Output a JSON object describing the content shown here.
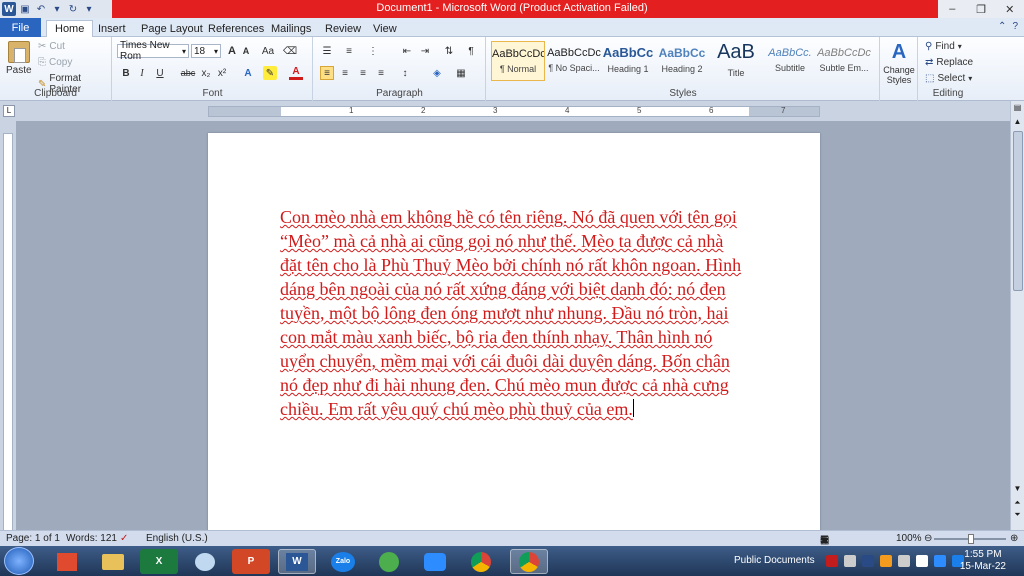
{
  "app": {
    "title": "Document1 - Microsoft Word (Product Activation Failed)",
    "logo_letter": "W"
  },
  "tabs": [
    "File",
    "Home",
    "Insert",
    "Page Layout",
    "References",
    "Mailings",
    "Review",
    "View"
  ],
  "clipboard": {
    "paste": "Paste",
    "cut": "Cut",
    "copy": "Copy",
    "format_painter": "Format Painter",
    "label": "Clipboard"
  },
  "font": {
    "name": "Times New Rom",
    "size": "18",
    "label": "Font",
    "bold": "B",
    "italic": "I",
    "underline": "U",
    "strike": "abc",
    "subscript": "x₂",
    "superscript": "x²",
    "grow": "A",
    "shrink": "A",
    "case": "Aa"
  },
  "paragraph": {
    "label": "Paragraph"
  },
  "styles": {
    "label": "Styles",
    "items": [
      {
        "sample": "AaBbCcDc",
        "name": "¶ Normal"
      },
      {
        "sample": "AaBbCcDc",
        "name": "¶ No Spaci..."
      },
      {
        "sample": "AaBbCc",
        "name": "Heading 1"
      },
      {
        "sample": "AaBbCc",
        "name": "Heading 2"
      },
      {
        "sample": "AaB",
        "name": "Title"
      },
      {
        "sample": "AaBbCc.",
        "name": "Subtitle"
      },
      {
        "sample": "AaBbCcDc",
        "name": "Subtle Em..."
      }
    ],
    "change_styles": "Change Styles"
  },
  "editing": {
    "label": "Editing",
    "find": "Find",
    "replace": "Replace",
    "select": "Select"
  },
  "ruler": {
    "numbers": [
      "1",
      "1",
      "2",
      "3",
      "4",
      "5",
      "6",
      "7"
    ]
  },
  "document": {
    "text": "Con mèo nhà em không hề có tên riêng. Nó đã quen với tên gọi “Mèo” mà cả nhà ai cũng gọi nó như thế. Mèo ta được cả nhà đặt tên cho là Phù Thuỷ Mèo bởi chính nó rất khôn ngoan. Hình dáng bên ngoài của nó rất xứng đáng với biệt danh đó: nó đen tuyền, một bộ lông đen óng mượt như nhung. Đầu nó tròn, hai con mắt màu xanh biếc, bộ ria đen thính nhạy. Thân hình nó uyển chuyển, mềm mại với cái đuôi dài duyên dáng. Bốn chân nó đẹp như đi hài nhung đen. Chú mèo mun được cả nhà cưng chiều. Em rất yêu quý chú mèo phù thuỷ của em."
  },
  "statusbar": {
    "page": "Page: 1 of 1",
    "words": "Words: 121",
    "language": "English (U.S.)",
    "zoom": "100%"
  },
  "taskbar": {
    "apps": [
      "",
      "",
      "X",
      "",
      "P",
      "W",
      "Zalo",
      "",
      "",
      "",
      ""
    ],
    "tray_label": "Public Documents",
    "time": "1:55 PM",
    "date": "15-Mar-22"
  },
  "colors": {
    "titlebar": "#e31f1f",
    "file_tab": "#2a66c0",
    "doc_text": "#d11b1b"
  }
}
